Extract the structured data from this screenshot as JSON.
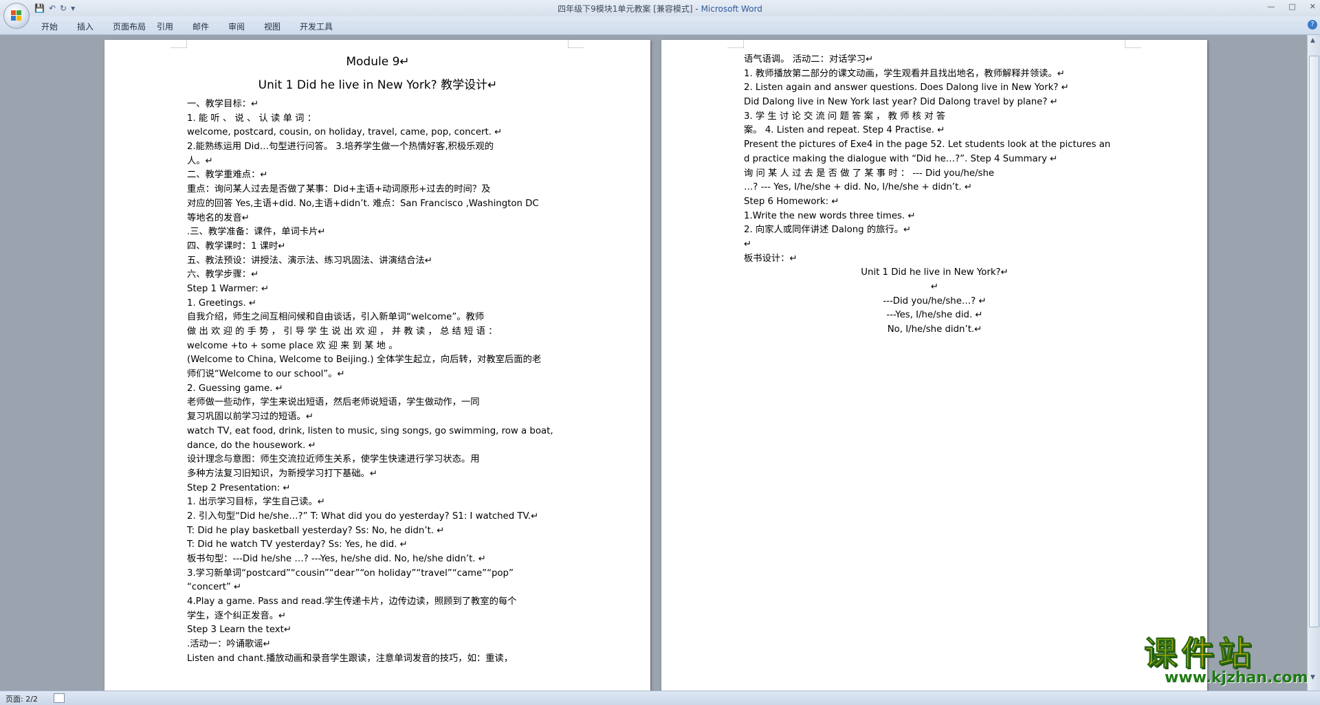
{
  "window": {
    "title_doc": "四年级下9模块1单元教案 [兼容模式]",
    "title_sep": " - ",
    "title_app": "Microsoft Word",
    "controls": [
      "—",
      "□",
      "✕"
    ]
  },
  "qat": {
    "save_icon": "💾",
    "undo_icon": "↶",
    "redo_icon": "↻",
    "more_icon": "▾"
  },
  "ribbon": {
    "tabs": [
      "开始",
      "插入",
      "页面布局",
      "引用",
      "邮件",
      "审阅",
      "视图",
      "开发工具"
    ],
    "help": "?"
  },
  "page1": {
    "lines": [
      {
        "cls": "h1",
        "text": "Module 9↵"
      },
      {
        "cls": "h2",
        "text": "Unit 1 Did he live in New York? 教学设计↵"
      },
      {
        "cls": "line",
        "text": "    一、教学目标：↵"
      },
      {
        "cls": "line",
        "text": "    1.  能   听   、  说   、  认   读   单   词   ："
      },
      {
        "cls": "line",
        "text": "welcome, postcard, cousin, on holiday, travel, came, pop, concert.     ↵"
      },
      {
        "cls": "line",
        "text": "    2.能熟练运用 Did…句型进行问答。    3.培养学生做一个热情好客,积极乐观的"
      },
      {
        "cls": "line",
        "text": "人。↵"
      },
      {
        "cls": "line",
        "text": "      二、教学重难点：↵"
      },
      {
        "cls": "line",
        "text": "       重点：询问某人过去是否做了某事：Did+主语+动词原形+过去的时间？及"
      },
      {
        "cls": "line",
        "text": "对应的回答 Yes,主语+did. No,主语+didn’t.    难点：San Francisco ,Washington DC"
      },
      {
        "cls": "line",
        "text": "等地名的发音↵"
      },
      {
        "cls": "line",
        "text": "    .三、教学准备：课件，单词卡片↵"
      },
      {
        "cls": "line",
        "text": "     四、教学课时：1 课时↵"
      },
      {
        "cls": "line",
        "text": "    五、教法预设：讲授法、演示法、练习巩固法、讲演结合法↵"
      },
      {
        "cls": "line",
        "text": "     六、教学步骤：↵"
      },
      {
        "cls": "line",
        "text": "     Step 1 Warmer: ↵"
      },
      {
        "cls": "line",
        "text": "    1. Greetings. ↵"
      },
      {
        "cls": "line",
        "text": "       自我介绍，师生之间互相问候和自由谈话，引入新单词“welcome”。教师"
      },
      {
        "cls": "line",
        "text": "做 出 欢 迎 的 手 势 ， 引 导 学 生 说 出 欢 迎 ， 并 教 读 ， 总 结 短 语 ："
      },
      {
        "cls": "line",
        "text": "welcome +to + some place          欢         迎         来         到         某         地         。"
      },
      {
        "cls": "line",
        "text": "(Welcome to China, Welcome to Beijing.) 全体学生起立，向后转，对教室后面的老"
      },
      {
        "cls": "line",
        "text": "师们说“Welcome to our school”。↵"
      },
      {
        "cls": "line",
        "text": "     2. Guessing game. ↵"
      },
      {
        "cls": "line",
        "text": "       老师做一些动作，学生来说出短语，然后老师说短语，学生做动作，一同"
      },
      {
        "cls": "line",
        "text": "复习巩固以前学习过的短语。↵"
      },
      {
        "cls": "line",
        "text": "    watch TV,  eat food, drink, listen to music, sing songs, go swimming,  row a boat,"
      },
      {
        "cls": "line",
        "text": "dance, do the housework. ↵"
      },
      {
        "cls": "line",
        "text": "       设计理念与意图：师生交流拉近师生关系，使学生快速进行学习状态。用"
      },
      {
        "cls": "line",
        "text": "多种方法复习旧知识，为新授学习打下基础。↵"
      },
      {
        "cls": "line",
        "text": "     Step 2 Presentation: ↵"
      },
      {
        "cls": "line",
        "text": "    1.  出示学习目标，学生自己读。↵"
      },
      {
        "cls": "line",
        "text": "    2. 引入句型“Did he/she…?”    T: What did you do yesterday?   S1: I watched TV.↵"
      },
      {
        "cls": "line",
        "text": "     T: Did he play basketball yesterday?   Ss: No, he didn’t. ↵"
      },
      {
        "cls": "line",
        "text": "     T: Did he watch TV yesterday?     Ss: Yes, he did. ↵"
      },
      {
        "cls": "line",
        "text": "    板书句型：---Did he/she …?          ---Yes, he/she did.            No, he/she didn’t. ↵"
      },
      {
        "cls": "line",
        "text": "    3.学习新单词“postcard”“cousin”“dear”“on holiday”“travel”“came”“pop”"
      },
      {
        "cls": "line",
        "text": "“concert” ↵"
      },
      {
        "cls": "line",
        "text": "    4.Play a game. Pass and read.学生传递卡片，边传边读，照顾到了教室的每个"
      },
      {
        "cls": "line",
        "text": "学生，逐个纠正发音。↵"
      },
      {
        "cls": "line",
        "text": "     Step 3 Learn the text↵"
      },
      {
        "cls": "line",
        "text": "    .活动一：吟诵歌谣↵"
      },
      {
        "cls": "line",
        "text": "      Listen and chant.播放动画和录音学生跟读，注意单词发音的技巧，如：重读，"
      }
    ]
  },
  "page2": {
    "lines": [
      {
        "cls": "line",
        "text": "语气语调。 活动二：对话学习↵"
      },
      {
        "cls": "line",
        "text": "     1. 教师播放第二部分的课文动画，学生观看并且找出地名，教师解释并领读。↵"
      },
      {
        "cls": "line",
        "text": "     2. Listen again and answer questions.     Does Dalong live in New York? ↵"
      },
      {
        "cls": "line",
        "text": "      Did Dalong live in New York last year?    Did Dalong travel by plane? ↵"
      },
      {
        "cls": "line",
        "text": "     3.    学   生   讨   论   交   流   问   题   答   案   ，   教   师   核   对   答"
      },
      {
        "cls": "line",
        "text": "案。 4. Listen and repeat. Step 4 Practise. ↵"
      },
      {
        "cls": "line",
        "text": "      Present the pictures of Exe4 in the page 52. Let students look at the pictures an"
      },
      {
        "cls": "line",
        "text": "d practice making the dialogue with “Did he…?”. Step 4 Summary ↵"
      },
      {
        "cls": "line",
        "text": "       询  问  某  人  过  去  是  否  做  了  某  事  时  ：        --- Did you/he/she"
      },
      {
        "cls": "line",
        "text": "…?     --- Yes, I/he/she + did.        No, I/he/she + didn’t. ↵"
      },
      {
        "cls": "line",
        "text": "     Step 6 Homework: ↵"
      },
      {
        "cls": "line",
        "text": "       1.Write the new words three times.      ↵"
      },
      {
        "cls": "line",
        "text": "       2. 向家人或同伴讲述 Dalong 的旅行。↵"
      },
      {
        "cls": "line",
        "text": "     ↵"
      },
      {
        "cls": "line",
        "text": "     板书设计：↵"
      },
      {
        "cls": "line center",
        "text": "Unit 1 Did he live in New York?↵"
      },
      {
        "cls": "line center",
        "text": "↵"
      },
      {
        "cls": "line center",
        "text": "---Did you/he/she…? ↵"
      },
      {
        "cls": "line center",
        "text": "---Yes, I/he/she did.       ↵"
      },
      {
        "cls": "line center",
        "text": "   No, I/he/she didn’t.↵"
      }
    ]
  },
  "status": {
    "page_info": "页面: 2/2"
  },
  "watermark": {
    "cn": "课件站",
    "url": "www.kjzhan.com"
  },
  "colors": {
    "ribbon": "#dfe8f4",
    "workspace": "#9aa3ae",
    "title_app": "#2f5a9b"
  }
}
